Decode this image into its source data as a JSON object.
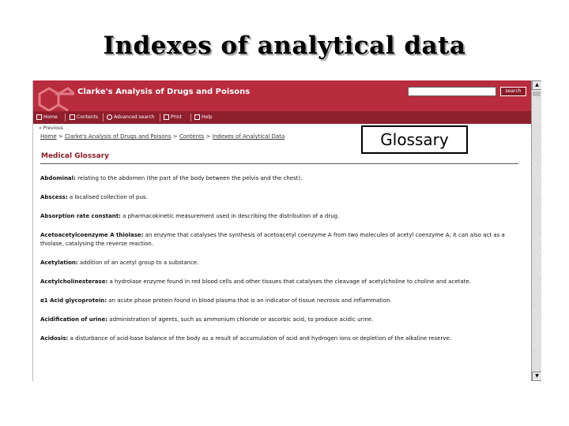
{
  "slide": {
    "title": "Indexes of analytical data"
  },
  "app": {
    "title": "Clarke's Analysis of Drugs and Poisons",
    "search_button": "search"
  },
  "nav": {
    "items": [
      {
        "label": "Home",
        "icon": "home-icon"
      },
      {
        "label": "Contents",
        "icon": "contents-icon"
      },
      {
        "label": "Advanced search",
        "icon": "magnifier-icon"
      },
      {
        "label": "Print",
        "icon": "print-icon"
      },
      {
        "label": "Help",
        "icon": "help-icon"
      }
    ]
  },
  "breadcrumb": {
    "previous": "« Previous",
    "items": [
      "Home",
      "Clarke's Analysis of Drugs and Poisons",
      "Contents",
      "Indexes of Analytical Data"
    ],
    "separator": ">"
  },
  "overlay": {
    "label": "Glossary"
  },
  "page": {
    "heading": "Medical Glossary"
  },
  "glossary": [
    {
      "term": "Abdominal:",
      "definition": " relating to the abdomen (the part of the body between the pelvis and the chest)."
    },
    {
      "term": "Abscess:",
      "definition": " a localised collection of pus."
    },
    {
      "term": "Absorption rate constant:",
      "definition": " a pharmacokinetic measurement used in describing the distribution of a drug."
    },
    {
      "term": "Acetoacetylcoenzyme A thiolase:",
      "definition": " an enzyme that catalyses the synthesis of acetoacetyl coenzyme A from two molecules of acetyl coenzyme A; it can also act as a thiolase, catalysing the reverse reaction."
    },
    {
      "term": "Acetylation:",
      "definition": " addition of an acetyl group to a substance."
    },
    {
      "term": "Acetylcholinesterase:",
      "definition": " a hydrolase enzyme found in red blood cells and other tissues that catalyses the cleavage of acetylcholine to choline and acetate."
    },
    {
      "term": "α1 Acid glycoprotein:",
      "definition": " an acute phase protein found in blood plasma that is an indicator of tissue necrosis and inflammation."
    },
    {
      "term": "Acidification of urine:",
      "definition": " administration of agents, such as ammonium chloride or ascorbic acid, to produce acidic urine."
    },
    {
      "term": "Acidosis:",
      "definition": " a disturbance of acid-base balance of the body as a result of accumulation of acid and hydrogen ions or depletion of the alkaline reserve."
    }
  ],
  "colors": {
    "brand": "#b82c3d",
    "nav": "#8f1f2c",
    "heading": "#8a1c28"
  }
}
